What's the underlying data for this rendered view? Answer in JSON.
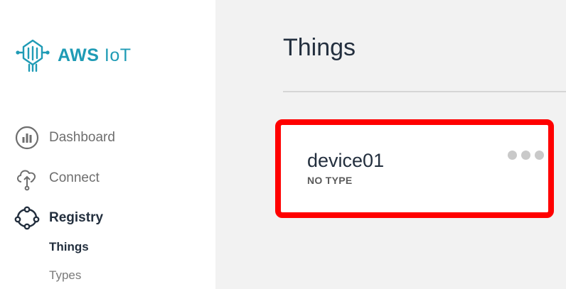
{
  "brand": {
    "name_bold": "AWS",
    "name_light": "IoT",
    "icon": "aws-iot-logo",
    "color": "#1f9bb5"
  },
  "sidebar": {
    "items": [
      {
        "label": "Dashboard",
        "icon": "dashboard-icon"
      },
      {
        "label": "Connect",
        "icon": "cloud-connect-icon"
      },
      {
        "label": "Registry",
        "icon": "registry-icon",
        "active": true
      }
    ],
    "sub_items": [
      {
        "label": "Things",
        "active": true
      },
      {
        "label": "Types",
        "active": false
      }
    ]
  },
  "main": {
    "title": "Things",
    "things": [
      {
        "name": "device01",
        "type": "NO TYPE",
        "menu_icon": "more-options-icon"
      }
    ],
    "highlight_color": "#ff0000"
  }
}
